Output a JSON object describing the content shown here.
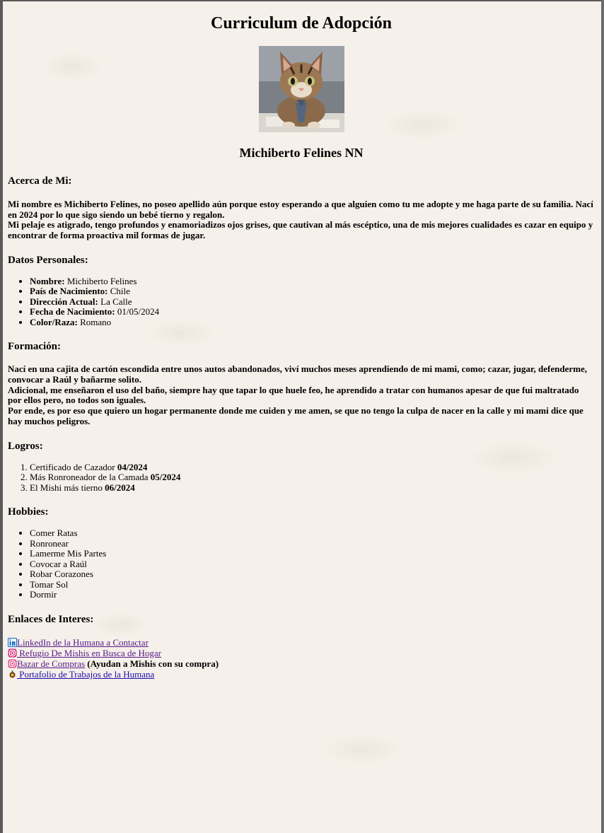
{
  "page": {
    "title": "Curriculum de Adopción",
    "name": "Michiberto Felines NN"
  },
  "about": {
    "heading": "Acerca de Mi:",
    "line1": "Mi nombre es Michiberto Felines, no poseo apellido aún porque estoy esperando a que alguien como tu me adopte y me haga parte de su familia. Nací en 2024 por lo que sigo siendo un bebé tierno y regalon.",
    "line2": "Mi pelaje es atigrado, tengo profundos y enamoriadizos ojos grises, que cautivan al más escéptico, una de mis mejores cualidades es cazar en equipo y encontrar de forma proactiva mil formas de jugar."
  },
  "personal": {
    "heading": "Datos Personales:",
    "items": [
      {
        "label": "Nombre:",
        "value": "Michiberto Felines"
      },
      {
        "label": "País de Nacimiento:",
        "value": "Chile"
      },
      {
        "label": "Dirección Actual:",
        "value": "La Calle"
      },
      {
        "label": "Fecha de Nacimiento:",
        "value": "01/05/2024"
      },
      {
        "label": "Color/Raza:",
        "value": "Romano"
      }
    ]
  },
  "education": {
    "heading": "Formación:",
    "line1": "Nací en una cajita de cartón escondida entre unos autos abandonados, viví muchos meses aprendiendo de mi mami, como; cazar, jugar, defenderme, convocar a Raúl y bañarme solito.",
    "line2": "Adicional, me enseñaron el uso del baño, siempre hay que tapar lo que huele feo, he aprendido a tratar con humanos apesar de que fui maltratado por ellos pero, no todos son iguales.",
    "line3": "Por ende, es por eso que quiero un hogar permanente donde me cuiden y me amen, se que no tengo la culpa de nacer en la calle y mi mami dice que hay muchos peligros."
  },
  "achievements": {
    "heading": "Logros:",
    "items": [
      {
        "text": "Certificado de Cazador",
        "date": "04/2024"
      },
      {
        "text": "Más Ronroneador de la Camada",
        "date": "05/2024"
      },
      {
        "text": "El Mishi más tierno",
        "date": "06/2024"
      }
    ]
  },
  "hobbies": {
    "heading": "Hobbies:",
    "items": [
      "Comer Ratas",
      "Ronronear",
      "Lamerme Mis Partes",
      "Covocar a Raúl",
      "Robar Corazones",
      "Tomar Sol",
      "Dormir"
    ]
  },
  "links": {
    "heading": "Enlaces de Interes:",
    "items": [
      {
        "icon": "linkedin-icon",
        "text": "LinkedIn de la Humana a Contactar",
        "note": ""
      },
      {
        "icon": "instagram-icon",
        "text": " Refugio De Mishis en Busca de Hogar",
        "note": ""
      },
      {
        "icon": "instagram-icon",
        "text": "Bazar de Compras",
        "note": " (Ayudan a Mishis con su compra)"
      },
      {
        "icon": "portfolio-icon",
        "text": " Portafolio de Trabajos de la Humana",
        "note": ""
      }
    ]
  },
  "colors": {
    "background": "#f6f0ea",
    "link": "#1a0dab",
    "visited_link": "#551a8b"
  }
}
